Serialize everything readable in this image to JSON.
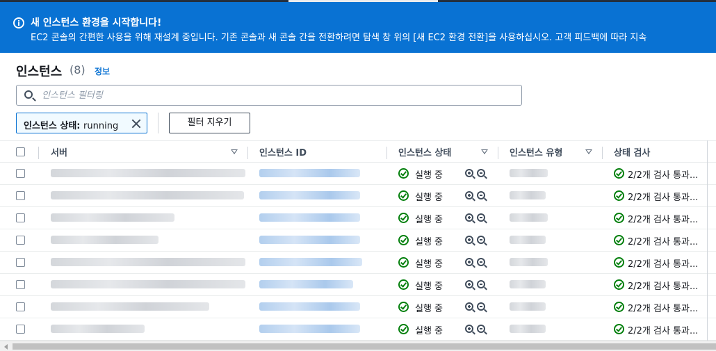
{
  "banner": {
    "title": "새 인스턴스 환경을 시작합니다!",
    "text": "EC2 콘솔의 간편한 사용을 위해 재설계 중입니다. 기존 콘솔과 새 콘솔 간을 전환하려면 탐색 창 위의 [새 EC2 환경 전환]을 사용하십시오. 고객 피드백에 따라 지속",
    "icon": "info-icon"
  },
  "header": {
    "title": "인스턴스",
    "count": "(8)",
    "info_link": "정보"
  },
  "search": {
    "placeholder": "인스턴스 필터링",
    "value": ""
  },
  "filter_token": {
    "key": "인스턴스 상태",
    "separator": ": ",
    "value": "running"
  },
  "clear_filters_label": "필터 지우기",
  "columns": [
    {
      "label": "서버",
      "sortable": true
    },
    {
      "label": "인스턴스 ID",
      "sortable": false
    },
    {
      "label": "인스턴스 상태",
      "sortable": true
    },
    {
      "label": "인스턴스 유형",
      "sortable": true
    },
    {
      "label": "상태 검사",
      "sortable": false
    }
  ],
  "rows": [
    {
      "state": "실행 중",
      "check": "2/2개 검사 통과..."
    },
    {
      "state": "실행 중",
      "check": "2/2개 검사 통과..."
    },
    {
      "state": "실행 중",
      "check": "2/2개 검사 통과..."
    },
    {
      "state": "실행 중",
      "check": "2/2개 검사 통과..."
    },
    {
      "state": "실행 중",
      "check": "2/2개 검사 통과..."
    },
    {
      "state": "실행 중",
      "check": "2/2개 검사 통과..."
    },
    {
      "state": "실행 중",
      "check": "2/2개 검사 통과..."
    },
    {
      "state": "실행 중",
      "check": "2/2개 검사 통과..."
    }
  ],
  "colors": {
    "banner_bg": "#0972d3",
    "link": "#0972d3",
    "success": "#037f0c",
    "token_bg": "#f1faff"
  }
}
